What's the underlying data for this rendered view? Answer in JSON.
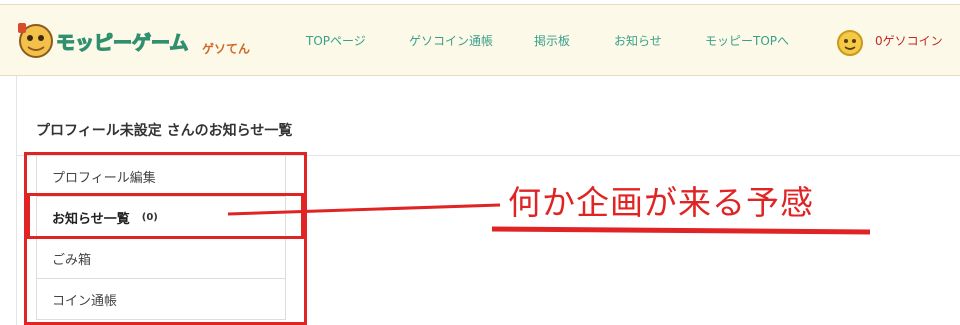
{
  "header": {
    "logo_text": "モッピーゲーム",
    "logo_sub": "ゲソてん",
    "nav": [
      {
        "label": "TOPページ"
      },
      {
        "label": "ゲソコイン通帳"
      },
      {
        "label": "掲示板"
      },
      {
        "label": "お知らせ"
      },
      {
        "label": "モッピーTOPへ"
      }
    ],
    "coin_count": "0ゲソコイン"
  },
  "page": {
    "title": "プロフィール未設定 さんのお知らせ一覧"
  },
  "menu": {
    "items": [
      {
        "label": "プロフィール編集"
      },
      {
        "label": "お知らせ一覧",
        "count": "(0)"
      },
      {
        "label": "ごみ箱"
      },
      {
        "label": "コイン通帳"
      }
    ]
  },
  "annotation": {
    "text": "何か企画が来る予感",
    "color": "#e02424"
  },
  "colors": {
    "header_bg": "#fdf9e8",
    "nav_text": "#3aa08a",
    "coin_text": "#c62828",
    "annotation_red": "#e02424"
  }
}
